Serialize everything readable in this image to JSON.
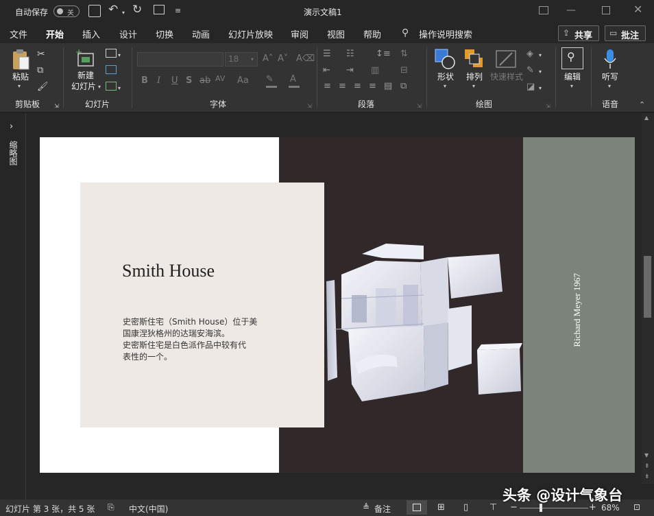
{
  "titlebar": {
    "autosave_label": "自动保存",
    "autosave_state": "关",
    "doc_title": "演示文稿1"
  },
  "menu": {
    "tabs": [
      "文件",
      "开始",
      "插入",
      "设计",
      "切换",
      "动画",
      "幻灯片放映",
      "审阅",
      "视图",
      "帮助"
    ],
    "active_tab": "开始",
    "tell_me": "操作说明搜索",
    "share": "共享",
    "comments": "批注"
  },
  "ribbon": {
    "paste": "粘贴",
    "clipboard_group": "剪贴板",
    "new_slide_line1": "新建",
    "new_slide_line2": "幻灯片",
    "slides_group": "幻灯片",
    "font_size": "18",
    "font_group": "字体",
    "paragraph_group": "段落",
    "shapes": "形状",
    "arrange": "排列",
    "quick_styles": "快速样式",
    "drawing_group": "绘图",
    "edit": "编辑",
    "dictate": "听写",
    "voice_group": "语音"
  },
  "thumbnail_pane": {
    "label": "缩略图"
  },
  "slide": {
    "title": "Smith House",
    "body": [
      "史密斯住宅（Smith House）位于美",
      "国康涅狄格州的达瑞安海滨。",
      "史密斯住宅是白色派作品中较有代",
      "表性的一个。"
    ],
    "vertical_caption": "Richard Meyer 1967",
    "colors": {
      "card": "#efe9e5",
      "dark_panel": "#302829",
      "gray_panel": "#7c837a",
      "white": "#ffffff"
    }
  },
  "status": {
    "slide_info": "幻灯片 第 3 张，共 5 张",
    "language": "中文(中国)",
    "notes": "备注",
    "zoom": "68%",
    "watermark": "头条 @设计气象台"
  }
}
